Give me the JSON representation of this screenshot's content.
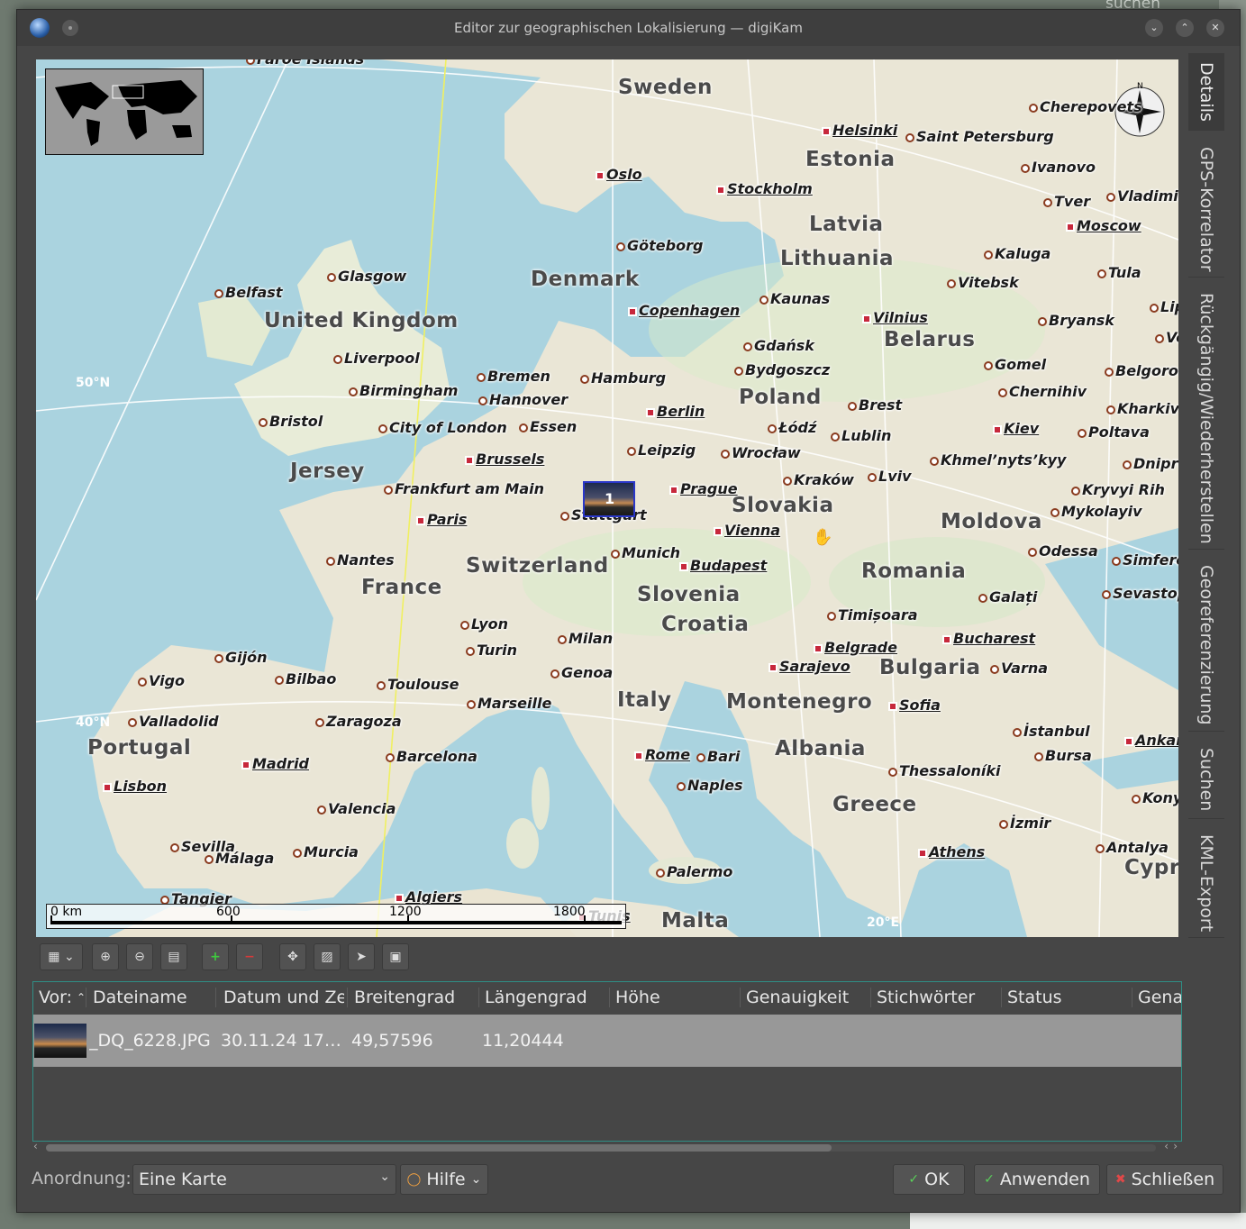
{
  "window": {
    "title": "Editor zur geographischen Lokalisierung — digiKam",
    "background_hint": "suchen"
  },
  "map": {
    "scale": {
      "labels": [
        "0 km",
        "600",
        "1200",
        "1800"
      ]
    },
    "grid_labels": [
      "50°N",
      "40°N",
      "20°E"
    ],
    "compass_label": "N",
    "marker_count": "1",
    "countries": [
      "Sweden",
      "Estonia",
      "Latvia",
      "Lithuania",
      "Denmark",
      "United Kingdom",
      "Belarus",
      "Poland",
      "Jersey",
      "Slovakia",
      "Moldova",
      "Switzerland",
      "France",
      "Slovenia",
      "Romania",
      "Croatia",
      "Bulgaria",
      "Italy",
      "Montenegro",
      "Albania",
      "Portugal",
      "Greece",
      "Malta",
      "Cypr"
    ],
    "cities": [
      {
        "name": "Helsinki",
        "cap": true
      },
      {
        "name": "Saint Petersburg",
        "cap": false
      },
      {
        "name": "Cherepovets",
        "cap": false
      },
      {
        "name": "Oslo",
        "cap": true
      },
      {
        "name": "Stockholm",
        "cap": true
      },
      {
        "name": "Ivanovo",
        "cap": false
      },
      {
        "name": "Tver",
        "cap": false
      },
      {
        "name": "Vladimir",
        "cap": false
      },
      {
        "name": "Moscow",
        "cap": true
      },
      {
        "name": "Göteborg",
        "cap": false
      },
      {
        "name": "Glasgow",
        "cap": false
      },
      {
        "name": "Belfast",
        "cap": false
      },
      {
        "name": "Kaluga",
        "cap": false
      },
      {
        "name": "Tula",
        "cap": false
      },
      {
        "name": "Vitebsk",
        "cap": false
      },
      {
        "name": "Copenhagen",
        "cap": true
      },
      {
        "name": "Kaunas",
        "cap": false
      },
      {
        "name": "Vilnius",
        "cap": true
      },
      {
        "name": "Bryansk",
        "cap": false
      },
      {
        "name": "Lipetsk",
        "cap": false
      },
      {
        "name": "Liverpool",
        "cap": false
      },
      {
        "name": "Gdańsk",
        "cap": false
      },
      {
        "name": "Voronezh",
        "cap": false
      },
      {
        "name": "Bremen",
        "cap": false
      },
      {
        "name": "Hamburg",
        "cap": false
      },
      {
        "name": "Bydgoszcz",
        "cap": false
      },
      {
        "name": "Gomel",
        "cap": false
      },
      {
        "name": "Belgorod",
        "cap": false
      },
      {
        "name": "Birmingham",
        "cap": false
      },
      {
        "name": "Chernihiv",
        "cap": false
      },
      {
        "name": "Hannover",
        "cap": false
      },
      {
        "name": "Berlin",
        "cap": true
      },
      {
        "name": "Brest",
        "cap": false
      },
      {
        "name": "Kharkiv",
        "cap": false
      },
      {
        "name": "Bristol",
        "cap": false
      },
      {
        "name": "City of London",
        "cap": false
      },
      {
        "name": "Essen",
        "cap": false
      },
      {
        "name": "Łódź",
        "cap": false
      },
      {
        "name": "Kiev",
        "cap": true
      },
      {
        "name": "Poltava",
        "cap": false
      },
      {
        "name": "Lublin",
        "cap": false
      },
      {
        "name": "Leipzig",
        "cap": false
      },
      {
        "name": "Wrocław",
        "cap": false
      },
      {
        "name": "Brussels",
        "cap": true
      },
      {
        "name": "Khmel’nyts’kyy",
        "cap": false
      },
      {
        "name": "Dnipro",
        "cap": false
      },
      {
        "name": "Kraków",
        "cap": false
      },
      {
        "name": "Lviv",
        "cap": false
      },
      {
        "name": "Frankfurt am Main",
        "cap": false
      },
      {
        "name": "Prague",
        "cap": true
      },
      {
        "name": "Kryvyi Rih",
        "cap": false
      },
      {
        "name": "Paris",
        "cap": true
      },
      {
        "name": "Stuttgart",
        "cap": false
      },
      {
        "name": "Mykolayiv",
        "cap": false
      },
      {
        "name": "Vienna",
        "cap": true
      },
      {
        "name": "Odessa",
        "cap": false
      },
      {
        "name": "Munich",
        "cap": false
      },
      {
        "name": "Nantes",
        "cap": false
      },
      {
        "name": "Simferopol",
        "cap": false
      },
      {
        "name": "Budapest",
        "cap": true
      },
      {
        "name": "Galați",
        "cap": false
      },
      {
        "name": "Sevastopol",
        "cap": false
      },
      {
        "name": "Lyon",
        "cap": false
      },
      {
        "name": "Timișoara",
        "cap": false
      },
      {
        "name": "Milan",
        "cap": false
      },
      {
        "name": "Bucharest",
        "cap": true
      },
      {
        "name": "Turin",
        "cap": false
      },
      {
        "name": "Belgrade",
        "cap": true
      },
      {
        "name": "Gijón",
        "cap": false
      },
      {
        "name": "Genoa",
        "cap": false
      },
      {
        "name": "Varna",
        "cap": false
      },
      {
        "name": "Sarajevo",
        "cap": true
      },
      {
        "name": "Vigo",
        "cap": false
      },
      {
        "name": "Bilbao",
        "cap": false
      },
      {
        "name": "Toulouse",
        "cap": false
      },
      {
        "name": "Marseille",
        "cap": false
      },
      {
        "name": "Sofia",
        "cap": true
      },
      {
        "name": "Valladolid",
        "cap": false
      },
      {
        "name": "Zaragoza",
        "cap": false
      },
      {
        "name": "İstanbul",
        "cap": false
      },
      {
        "name": "Ankara",
        "cap": true
      },
      {
        "name": "Madrid",
        "cap": true
      },
      {
        "name": "Rome",
        "cap": true
      },
      {
        "name": "Bari",
        "cap": false
      },
      {
        "name": "Barcelona",
        "cap": false
      },
      {
        "name": "Bursa",
        "cap": false
      },
      {
        "name": "Thessaloníki",
        "cap": false
      },
      {
        "name": "Lisbon",
        "cap": true
      },
      {
        "name": "Naples",
        "cap": false
      },
      {
        "name": "Valencia",
        "cap": false
      },
      {
        "name": "Konya",
        "cap": false
      },
      {
        "name": "İzmir",
        "cap": false
      },
      {
        "name": "Sevilla",
        "cap": false
      },
      {
        "name": "Málaga",
        "cap": false
      },
      {
        "name": "Murcia",
        "cap": false
      },
      {
        "name": "Athens",
        "cap": true
      },
      {
        "name": "Antalya",
        "cap": false
      },
      {
        "name": "Palermo",
        "cap": false
      },
      {
        "name": "Tangier",
        "cap": false
      },
      {
        "name": "Algiers",
        "cap": true
      },
      {
        "name": "Tunis",
        "cap": true
      },
      {
        "name": "Faroe Islands",
        "cap": false
      }
    ]
  },
  "side_tabs": [
    "Details",
    "GPS-Korrelator",
    "Rückgängig/Wiederherstellen",
    "Georeferenzierung",
    "Suchen",
    "KML-Export"
  ],
  "toolbar": {
    "icons": [
      "map-layers-icon",
      "zoom-in-icon",
      "zoom-out-icon",
      "show-all-icon",
      "add-marker-icon",
      "remove-marker-icon",
      "move-icon",
      "filter-icon",
      "pointer-icon",
      "bookmark-add-icon"
    ]
  },
  "table": {
    "columns": [
      "Vor:",
      "Dateiname",
      "Datum und Ze",
      "Breitengrad",
      "Längengrad",
      "Höhe",
      "Genauigkeit",
      "Stichwörter",
      "Status",
      "Gena"
    ],
    "rows": [
      {
        "filename": "_DQ_6228.JPG",
        "date": "30.11.24 17…",
        "lat": "49,57596",
        "lon": "11,20444"
      }
    ]
  },
  "bottom": {
    "layout_label": "Anordnung:",
    "layout_value": "Eine Karte",
    "help_label": "Hilfe",
    "ok_label": "OK",
    "apply_label": "Anwenden",
    "close_label": "Schließen"
  }
}
